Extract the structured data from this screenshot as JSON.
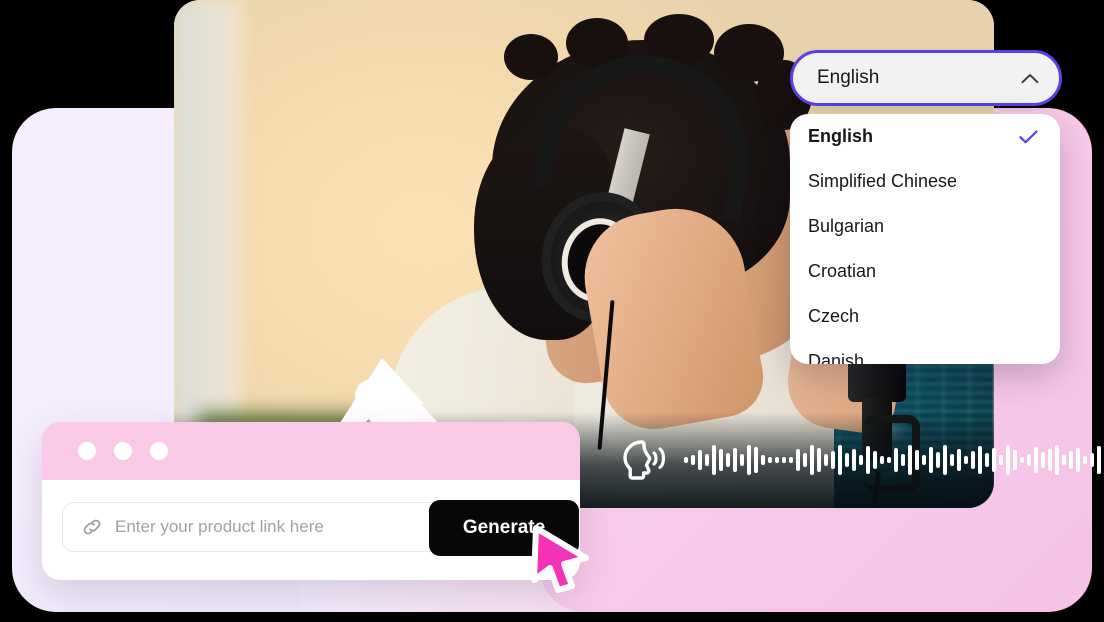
{
  "language_select": {
    "name": "language-dropdown",
    "value": "English",
    "chevron_icon": "chevron-up-icon",
    "border_color": "#5B3FE8",
    "background_color": "#F2F2F3"
  },
  "language_menu": {
    "check_icon": "check-icon",
    "check_color": "#5B3FE8",
    "items": [
      {
        "label": "English",
        "selected": true
      },
      {
        "label": "Simplified Chinese",
        "selected": false
      },
      {
        "label": "Bulgarian",
        "selected": false
      },
      {
        "label": "Croatian",
        "selected": false
      },
      {
        "label": "Czech",
        "selected": false
      },
      {
        "label": "Danish",
        "selected": false
      }
    ]
  },
  "browser_card": {
    "titlebar_color": "#FAC9E8",
    "dots": [
      "window-dot-1",
      "window-dot-2",
      "window-dot-3"
    ],
    "input": {
      "icon": "link-icon",
      "value": "",
      "placeholder": "Enter your product link here"
    },
    "generate_button": {
      "label": "Generate",
      "background_color": "#080808",
      "text_color": "#FFFFFF"
    }
  },
  "audio_overlay": {
    "icon": "speaking-head-icon",
    "color": "#FFFFFF",
    "waveform_heights": [
      6,
      10,
      20,
      12,
      30,
      22,
      14,
      24,
      12,
      30,
      26,
      10,
      6,
      6,
      6,
      6,
      22,
      14,
      30,
      24,
      12,
      18,
      30,
      14,
      22,
      10,
      28,
      18,
      8,
      6,
      24,
      12,
      30,
      20,
      10,
      26,
      16,
      30,
      12,
      22,
      8,
      18,
      28,
      14,
      24,
      10,
      30,
      20,
      6,
      12,
      26,
      16,
      22,
      30,
      10,
      18,
      24,
      8,
      14,
      28,
      20,
      10,
      6
    ]
  },
  "cursor": {
    "name": "mouse-cursor",
    "color": "#F531B8",
    "outline_color": "#FFFFFF"
  },
  "arrow": {
    "name": "curved-up-arrow",
    "color": "#FFFFFF"
  },
  "photo": {
    "alt": "man wearing headphones in front of a studio microphone",
    "corner_radius_px": 26
  },
  "background": {
    "lavender": "#F4EDFD",
    "pink": "#F9CBEA"
  }
}
